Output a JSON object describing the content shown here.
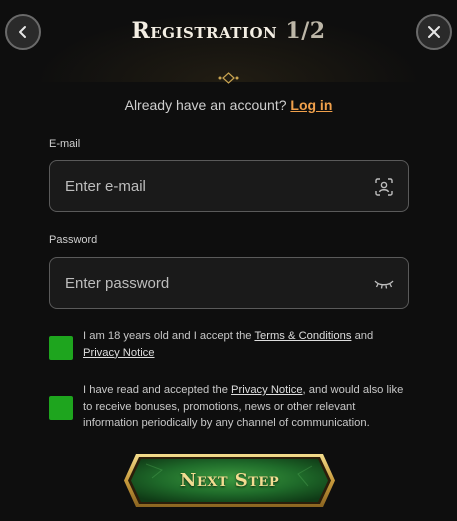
{
  "header": {
    "title": "Registration",
    "step": "1/2",
    "back_icon": "chevron-left-icon",
    "close_icon": "close-icon"
  },
  "login_prompt": {
    "text": "Already have an account?",
    "link": "Log in"
  },
  "email": {
    "label": "E-mail",
    "placeholder": "Enter e-mail",
    "value": "",
    "icon": "face-scan-icon"
  },
  "password": {
    "label": "Password",
    "placeholder": "Enter password",
    "value": "",
    "icon": "eye-closed-icon"
  },
  "consents": [
    {
      "checked": true,
      "text_before": "I am 18 years old and I accept the",
      "link1": "Terms & Conditions",
      "text_mid": "and",
      "link2": "Privacy Notice"
    },
    {
      "checked": true,
      "text_before": "I have read and accepted the",
      "link": "Privacy Notice",
      "text_after": ", and would also like to receive bonuses, promotions, news or other relevant information periodically by any channel of communication."
    }
  ],
  "next_button": {
    "label": "Next Step"
  },
  "colors": {
    "background": "#0e0e0e",
    "accent_link": "#f0a04b",
    "checkbox_green": "#1ea51e",
    "button_green": "#1f6b2a",
    "button_gold": "#d4b25a"
  }
}
